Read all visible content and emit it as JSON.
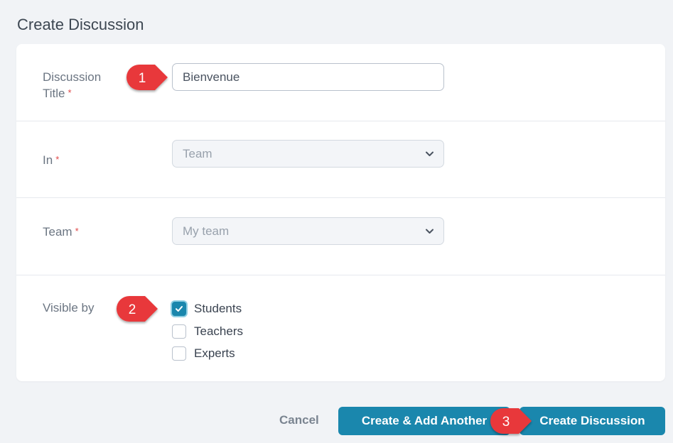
{
  "page": {
    "title": "Create Discussion"
  },
  "form": {
    "required_mark": "*",
    "title_label_line1": "Discussion",
    "title_label_line2": "Title",
    "title_value": "Bienvenue",
    "in_label": "In",
    "in_value": "Team",
    "team_label": "Team",
    "team_value": "My team",
    "visible_label": "Visible by",
    "visible_options": [
      {
        "label": "Students",
        "checked": true
      },
      {
        "label": "Teachers",
        "checked": false
      },
      {
        "label": "Experts",
        "checked": false
      }
    ]
  },
  "footer": {
    "cancel_label": "Cancel",
    "add_another_label": "Create & Add Another",
    "create_label": "Create Discussion"
  },
  "annotations": {
    "step1": "1",
    "step2": "2",
    "step3": "3"
  },
  "colors": {
    "accent": "#1a87ad",
    "marker": "#e8393b",
    "required": "#e04848"
  },
  "icons": {
    "dropdown": "chevron-down-icon",
    "check": "checkmark-icon"
  }
}
